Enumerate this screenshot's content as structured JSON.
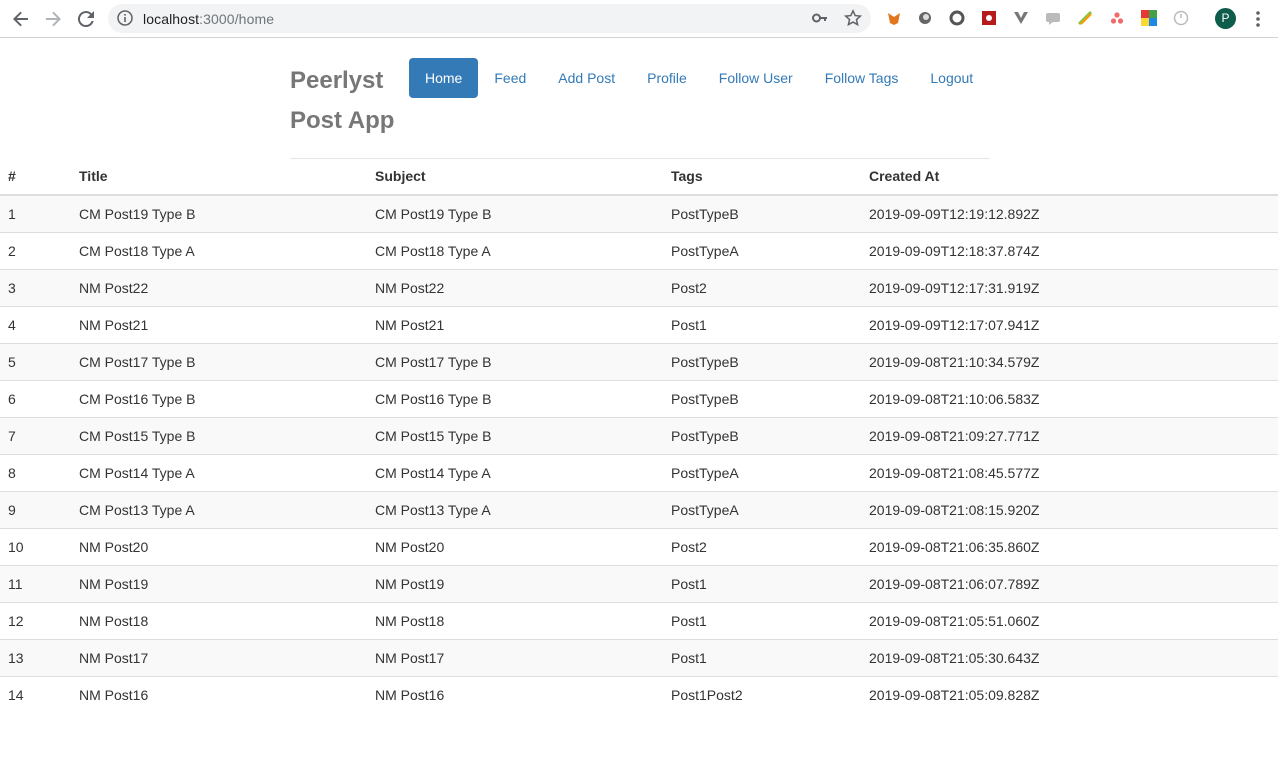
{
  "browser": {
    "url_host": "localhost",
    "url_path": ":3000/home",
    "profile_initial": "P"
  },
  "app": {
    "brand": "Peerlyst Post App",
    "nav": [
      {
        "label": "Home",
        "active": true
      },
      {
        "label": "Feed"
      },
      {
        "label": "Add Post"
      },
      {
        "label": "Profile"
      },
      {
        "label": "Follow User"
      },
      {
        "label": "Follow Tags"
      },
      {
        "label": "Logout"
      }
    ]
  },
  "table": {
    "columns": [
      "#",
      "Title",
      "Subject",
      "Tags",
      "Created At"
    ],
    "rows": [
      [
        "1",
        "CM Post19 Type B",
        "CM Post19 Type B",
        "PostTypeB",
        "2019-09-09T12:19:12.892Z"
      ],
      [
        "2",
        "CM Post18 Type A",
        "CM Post18 Type A",
        "PostTypeA",
        "2019-09-09T12:18:37.874Z"
      ],
      [
        "3",
        "NM Post22",
        "NM Post22",
        "Post2",
        "2019-09-09T12:17:31.919Z"
      ],
      [
        "4",
        "NM Post21",
        "NM Post21",
        "Post1",
        "2019-09-09T12:17:07.941Z"
      ],
      [
        "5",
        "CM Post17 Type B",
        "CM Post17 Type B",
        "PostTypeB",
        "2019-09-08T21:10:34.579Z"
      ],
      [
        "6",
        "CM Post16 Type B",
        "CM Post16 Type B",
        "PostTypeB",
        "2019-09-08T21:10:06.583Z"
      ],
      [
        "7",
        "CM Post15 Type B",
        "CM Post15 Type B",
        "PostTypeB",
        "2019-09-08T21:09:27.771Z"
      ],
      [
        "8",
        "CM Post14 Type A",
        "CM Post14 Type A",
        "PostTypeA",
        "2019-09-08T21:08:45.577Z"
      ],
      [
        "9",
        "CM Post13 Type A",
        "CM Post13 Type A",
        "PostTypeA",
        "2019-09-08T21:08:15.920Z"
      ],
      [
        "10",
        "NM Post20",
        "NM Post20",
        "Post2",
        "2019-09-08T21:06:35.860Z"
      ],
      [
        "11",
        "NM Post19",
        "NM Post19",
        "Post1",
        "2019-09-08T21:06:07.789Z"
      ],
      [
        "12",
        "NM Post18",
        "NM Post18",
        "Post1",
        "2019-09-08T21:05:51.060Z"
      ],
      [
        "13",
        "NM Post17",
        "NM Post17",
        "Post1",
        "2019-09-08T21:05:30.643Z"
      ],
      [
        "14",
        "NM Post16",
        "NM Post16",
        "Post1Post2",
        "2019-09-08T21:05:09.828Z"
      ]
    ]
  },
  "colors": {
    "primary": "#337ab7",
    "brand_text": "#777777",
    "stripe": "#f9f9f9",
    "border": "#dddddd"
  },
  "icons": [
    "back-arrow-icon",
    "forward-arrow-icon",
    "reload-icon",
    "info-icon",
    "key-icon",
    "star-icon",
    "kebab-menu-icon"
  ]
}
